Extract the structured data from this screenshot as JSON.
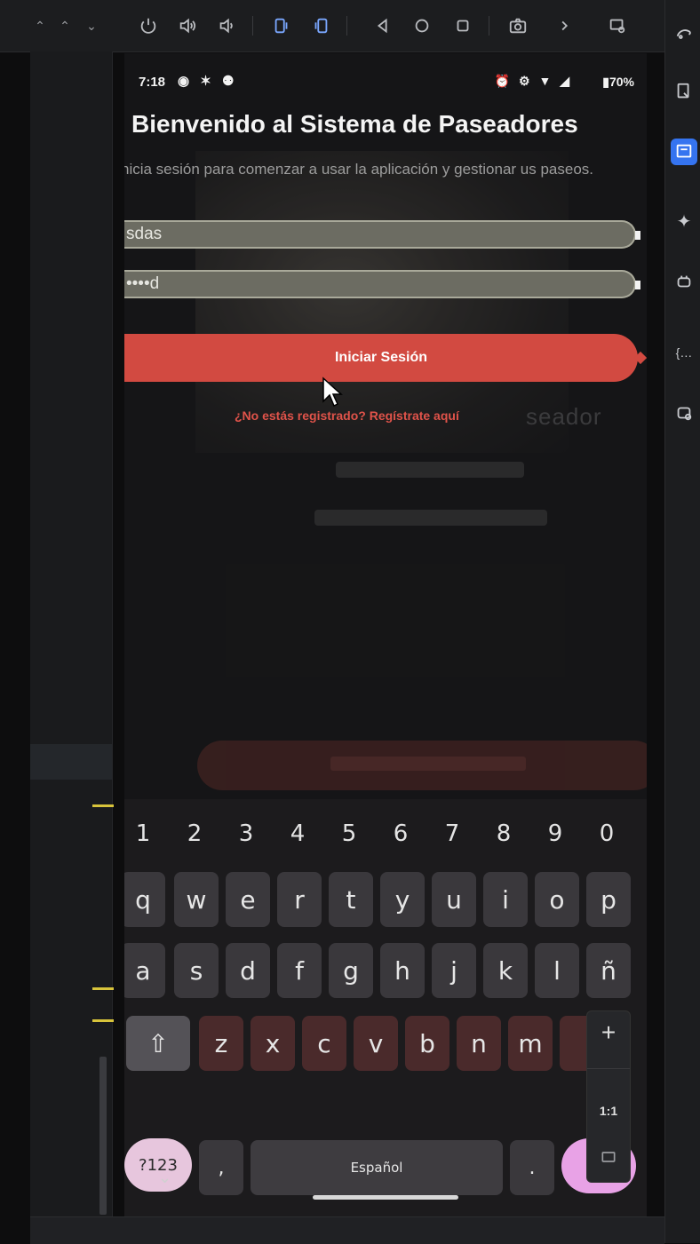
{
  "emulator_toolbar": {
    "icons": [
      "power-icon",
      "volume-up-icon",
      "volume-down-icon",
      "rotate-left-icon",
      "rotate-right-icon",
      "back-icon",
      "home-icon",
      "overview-icon",
      "camera-icon",
      "chevron-right-icon",
      "device-manager-icon"
    ]
  },
  "phone": {
    "status_bar": {
      "time": "7:18",
      "left_icons": "◉ ✶ ⚉",
      "right_icons": "⏰ ⚙ ▼ ◢",
      "battery": "70%"
    },
    "title": "Bienvenido al Sistema de Paseadores",
    "subtitle": "nicia sesión para comenzar a usar la aplicación y gestionar us paseos.",
    "username_value": "sdas",
    "password_value": "••••d",
    "login_button": "Iniciar Sesión",
    "register_link": "¿No estás registrado? Regístrate aquí",
    "background_text": "seador"
  },
  "keyboard": {
    "numbers": [
      "1",
      "2",
      "3",
      "4",
      "5",
      "6",
      "7",
      "8",
      "9",
      "0"
    ],
    "row1": [
      "q",
      "w",
      "e",
      "r",
      "t",
      "y",
      "u",
      "i",
      "o",
      "p"
    ],
    "row2": [
      "a",
      "s",
      "d",
      "f",
      "g",
      "h",
      "j",
      "k",
      "l",
      "ñ"
    ],
    "row3": [
      "z",
      "x",
      "c",
      "v",
      "b",
      "n",
      "m"
    ],
    "shift": "⇧",
    "symbols_key": "?123",
    "comma": ",",
    "space_label": "Español",
    "period": ".",
    "hide_keyboard": "⌄"
  },
  "zoom_controls": {
    "zoom_in": "+",
    "ratio": "1:1"
  },
  "colors": {
    "primary_button": "#d24a41",
    "link": "#e0534a",
    "ide_accent": "#3574f0"
  }
}
